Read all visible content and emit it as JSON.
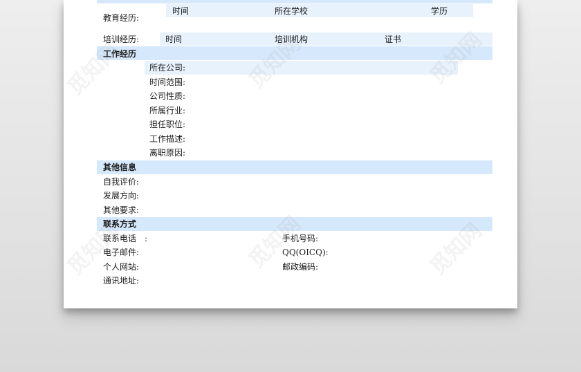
{
  "education": {
    "label": "教育经历:",
    "col_time": "时间",
    "col_school": "所在学校",
    "col_degree": "学历"
  },
  "training": {
    "label": "培训经历:",
    "col_time": "时间",
    "col_org": "培训机构",
    "col_cert": "证书"
  },
  "work": {
    "heading": "工作经历",
    "fields": [
      "所在公司:",
      "时间范围:",
      "公司性质:",
      "所属行业:",
      "担任职位:",
      "工作描述:",
      "离职原因:"
    ]
  },
  "other": {
    "heading": "其他信息",
    "fields": [
      "自我评价:",
      "发展方向:",
      "其他要求:"
    ]
  },
  "contact": {
    "heading": "联系方式",
    "phone": "联系电话　:",
    "mobile": "手机号码:",
    "email": "电子邮件:",
    "qq": "QQ(OICQ):",
    "website": "个人网站:",
    "postcode": "邮政编码:",
    "address": "通讯地址:"
  },
  "watermark": "觅知网",
  "colors": {
    "band": "#d6e8fb",
    "band_light": "#e8f2fd",
    "paper": "#ffffff"
  }
}
